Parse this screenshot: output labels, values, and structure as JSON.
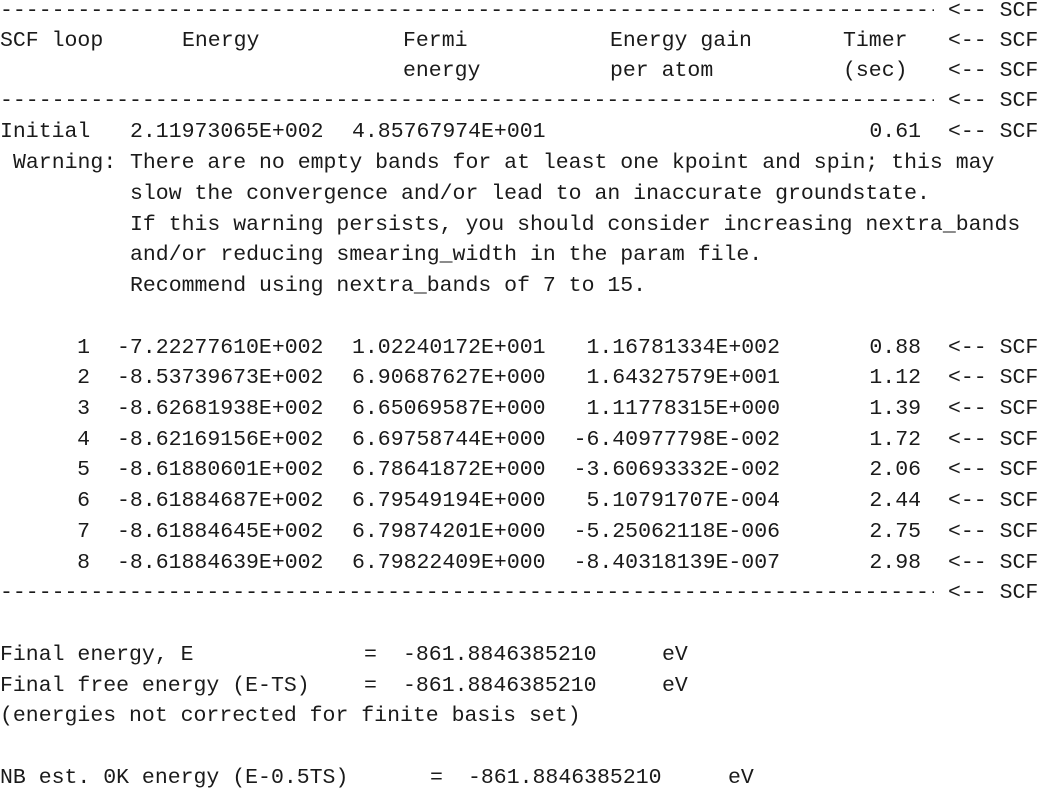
{
  "scf_tag": "<-- SCF",
  "rule_dashes": "------------------------------------------------------------------------------------------------------------------------------------",
  "header": {
    "row1": {
      "loop": "SCF loop",
      "energy": "Energy",
      "fermi": "Fermi",
      "gain": "Energy gain",
      "timer": "Timer"
    },
    "row2": {
      "fermi": "energy",
      "gain": "per atom",
      "timer": "(sec)"
    }
  },
  "initial": {
    "label": "Initial",
    "energy": "2.11973065E+002",
    "fermi": "4.85767974E+001",
    "timer": "0.61"
  },
  "warning": {
    "label": "Warning:",
    "lines": [
      "There are no empty bands for at least one kpoint and spin; this may",
      "slow the convergence and/or lead to an inaccurate groundstate.",
      "If this warning persists, you should consider increasing nextra_bands",
      "and/or reducing smearing_width in the param file.",
      "Recommend using nextra_bands of 7 to 15."
    ]
  },
  "iterations": [
    {
      "n": "1",
      "energy": "-7.22277610E+002",
      "fermi": "1.02240172E+001",
      "gain": "1.16781334E+002",
      "timer": "0.88"
    },
    {
      "n": "2",
      "energy": "-8.53739673E+002",
      "fermi": "6.90687627E+000",
      "gain": "1.64327579E+001",
      "timer": "1.12"
    },
    {
      "n": "3",
      "energy": "-8.62681938E+002",
      "fermi": "6.65069587E+000",
      "gain": "1.11778315E+000",
      "timer": "1.39"
    },
    {
      "n": "4",
      "energy": "-8.62169156E+002",
      "fermi": "6.69758744E+000",
      "gain": "-6.40977798E-002",
      "timer": "1.72"
    },
    {
      "n": "5",
      "energy": "-8.61880601E+002",
      "fermi": "6.78641872E+000",
      "gain": "-3.60693332E-002",
      "timer": "2.06"
    },
    {
      "n": "6",
      "energy": "-8.61884687E+002",
      "fermi": "6.79549194E+000",
      "gain": "5.10791707E-004",
      "timer": "2.44"
    },
    {
      "n": "7",
      "energy": "-8.61884645E+002",
      "fermi": "6.79874201E+000",
      "gain": "-5.25062118E-006",
      "timer": "2.75"
    },
    {
      "n": "8",
      "energy": "-8.61884639E+002",
      "fermi": "6.79822409E+000",
      "gain": "-8.40318139E-007",
      "timer": "2.98"
    }
  ],
  "results": {
    "final_energy": {
      "label": "Final energy, E",
      "eq": "=",
      "value": "-861.8846385210",
      "unit": "eV"
    },
    "final_free_energy": {
      "label": "Final free energy (E-TS)",
      "eq": "=",
      "value": "-861.8846385210",
      "unit": "eV"
    },
    "note": "(energies not corrected for finite basis set)",
    "nb_energy": {
      "label": "NB est. 0K energy (E-0.5TS)",
      "eq": "=",
      "value": "-861.8846385210",
      "unit": "eV"
    }
  }
}
